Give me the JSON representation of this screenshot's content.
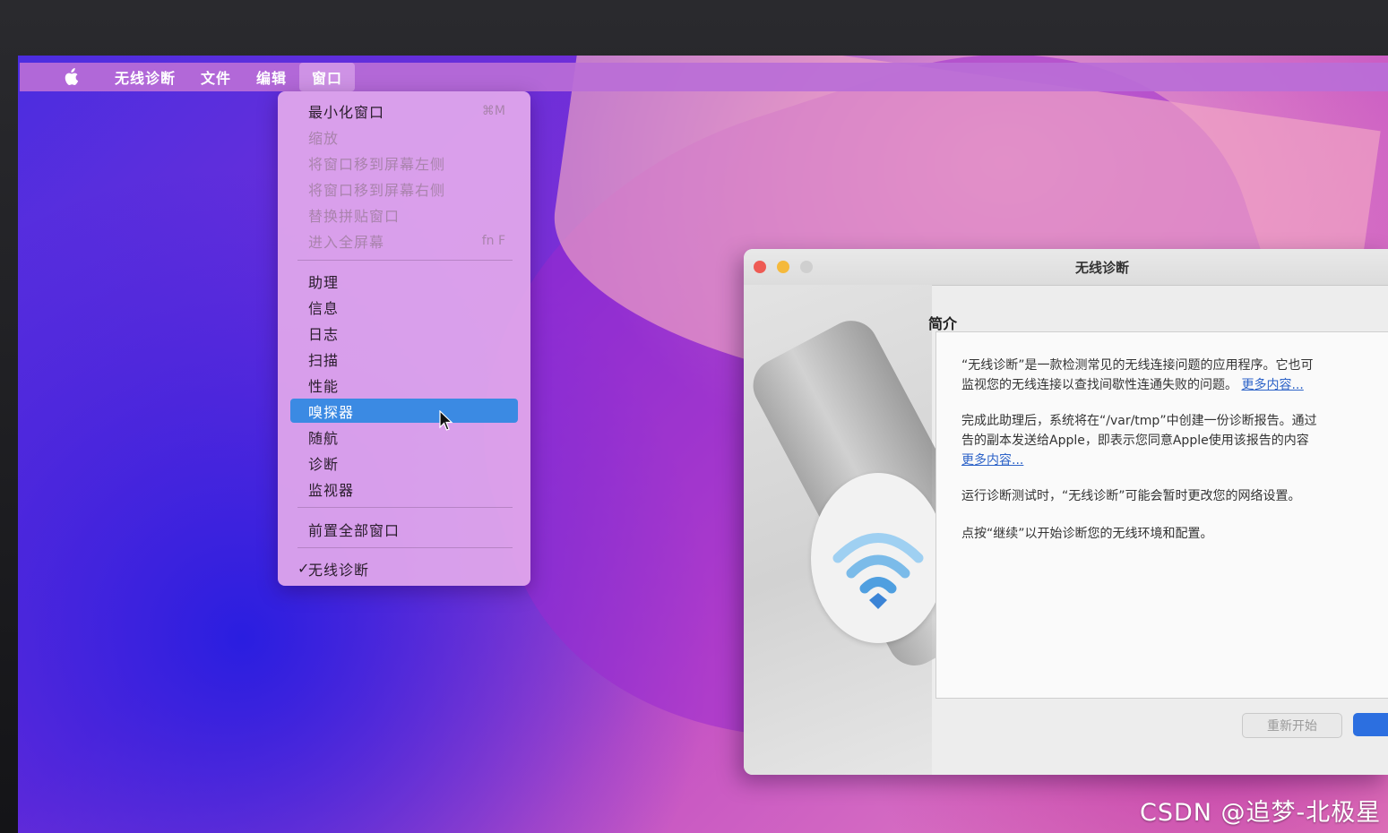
{
  "menubar": {
    "apple_icon": "apple-icon",
    "items": [
      "无线诊断",
      "文件",
      "编辑",
      "窗口"
    ],
    "active_index": 3
  },
  "window_menu": {
    "items": [
      {
        "label": "最小化窗口",
        "shortcut": "⌘M",
        "disabled": false
      },
      {
        "label": "缩放",
        "disabled": true
      },
      {
        "label": "将窗口移到屏幕左侧",
        "disabled": true
      },
      {
        "label": "将窗口移到屏幕右侧",
        "disabled": true
      },
      {
        "label": "替换拼贴窗口",
        "disabled": true
      },
      {
        "label": "进入全屏幕",
        "shortcut": "fn F",
        "disabled": true
      },
      {
        "label": "助理"
      },
      {
        "label": "信息"
      },
      {
        "label": "日志"
      },
      {
        "label": "扫描"
      },
      {
        "label": "性能"
      },
      {
        "label": "嗅探器",
        "highlighted": true
      },
      {
        "label": "随航"
      },
      {
        "label": "诊断"
      },
      {
        "label": "监视器"
      },
      {
        "label": "前置全部窗口"
      },
      {
        "label": "无线诊断",
        "checked": true
      }
    ]
  },
  "window": {
    "title": "无线诊断",
    "section_title": "简介",
    "paragraphs": [
      {
        "line1": "“无线诊断”是一款检测常见的无线连接问题的应用程序。它也可",
        "line2": "监视您的无线连接以查找间歇性连通失败的问题。",
        "link": "更多内容..."
      },
      {
        "line1": "完成此助理后，系统将在“/var/tmp”中创建一份诊断报告。通过",
        "line2": "告的副本发送给Apple，即表示您同意Apple使用该报告的内容",
        "link": "更多内容..."
      },
      {
        "line1": "运行诊断测试时，“无线诊断”可能会暂时更改您的网络设置。"
      },
      {
        "line1": "点按“继续”以开始诊断您的无线环境和配置。"
      }
    ],
    "buttons": {
      "restart": "重新开始"
    }
  },
  "watermark": "CSDN @追梦-北极星",
  "colors": {
    "highlight": "#3b8ae3",
    "link": "#2d63c8",
    "close": "#ee5b54",
    "minimize": "#f5b93c"
  }
}
